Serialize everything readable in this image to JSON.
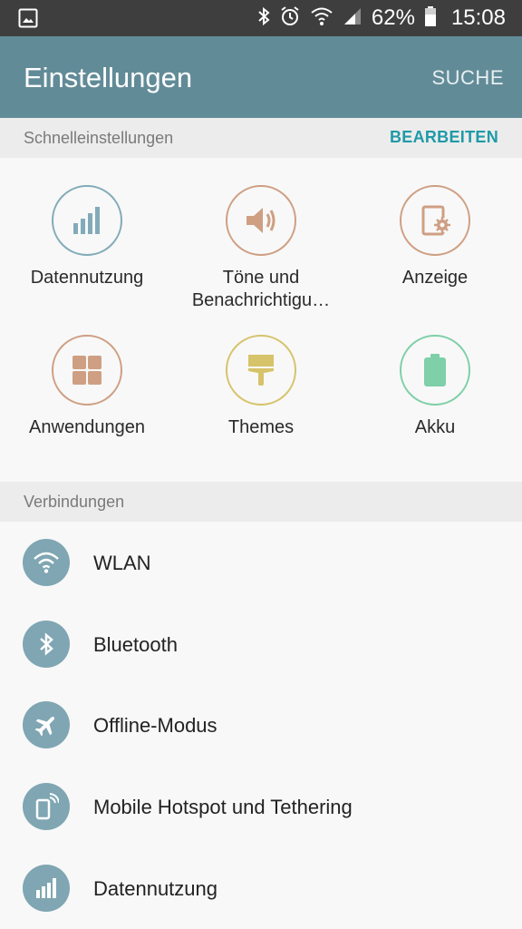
{
  "status_bar": {
    "battery_percent": "62%",
    "time": "15:08",
    "icons": [
      "image-icon",
      "bluetooth-icon",
      "alarm-icon",
      "wifi-icon",
      "signal-icon",
      "battery-icon"
    ]
  },
  "app_bar": {
    "title": "Einstellungen",
    "search_label": "SUCHE"
  },
  "quick_settings": {
    "header": "Schnelleinstellungen",
    "edit_label": "BEARBEITEN",
    "items": [
      {
        "label": "Datennutzung",
        "icon": "data-usage-icon",
        "color": "#82abb9"
      },
      {
        "label": "Töne und Benachrichtigu…",
        "icon": "volume-icon",
        "color": "#cf9f83"
      },
      {
        "label": "Anzeige",
        "icon": "display-settings-icon",
        "color": "#cf9f83"
      },
      {
        "label": "Anwendungen",
        "icon": "apps-icon",
        "color": "#cf9f83"
      },
      {
        "label": "Themes",
        "icon": "paintbrush-icon",
        "color": "#d6c36a"
      },
      {
        "label": "Akku",
        "icon": "battery-icon",
        "color": "#7fcfa8"
      }
    ]
  },
  "connections": {
    "header": "Verbindungen",
    "items": [
      {
        "label": "WLAN",
        "icon": "wifi-icon"
      },
      {
        "label": "Bluetooth",
        "icon": "bluetooth-icon"
      },
      {
        "label": "Offline-Modus",
        "icon": "airplane-icon"
      },
      {
        "label": "Mobile Hotspot und Tethering",
        "icon": "hotspot-icon"
      },
      {
        "label": "Datennutzung",
        "icon": "data-usage-icon"
      }
    ]
  },
  "colors": {
    "status_bar": "#3e3e3e",
    "app_bar": "#628b98",
    "accent": "#1f9aa8",
    "list_icon_bg": "#7fa6b2"
  }
}
